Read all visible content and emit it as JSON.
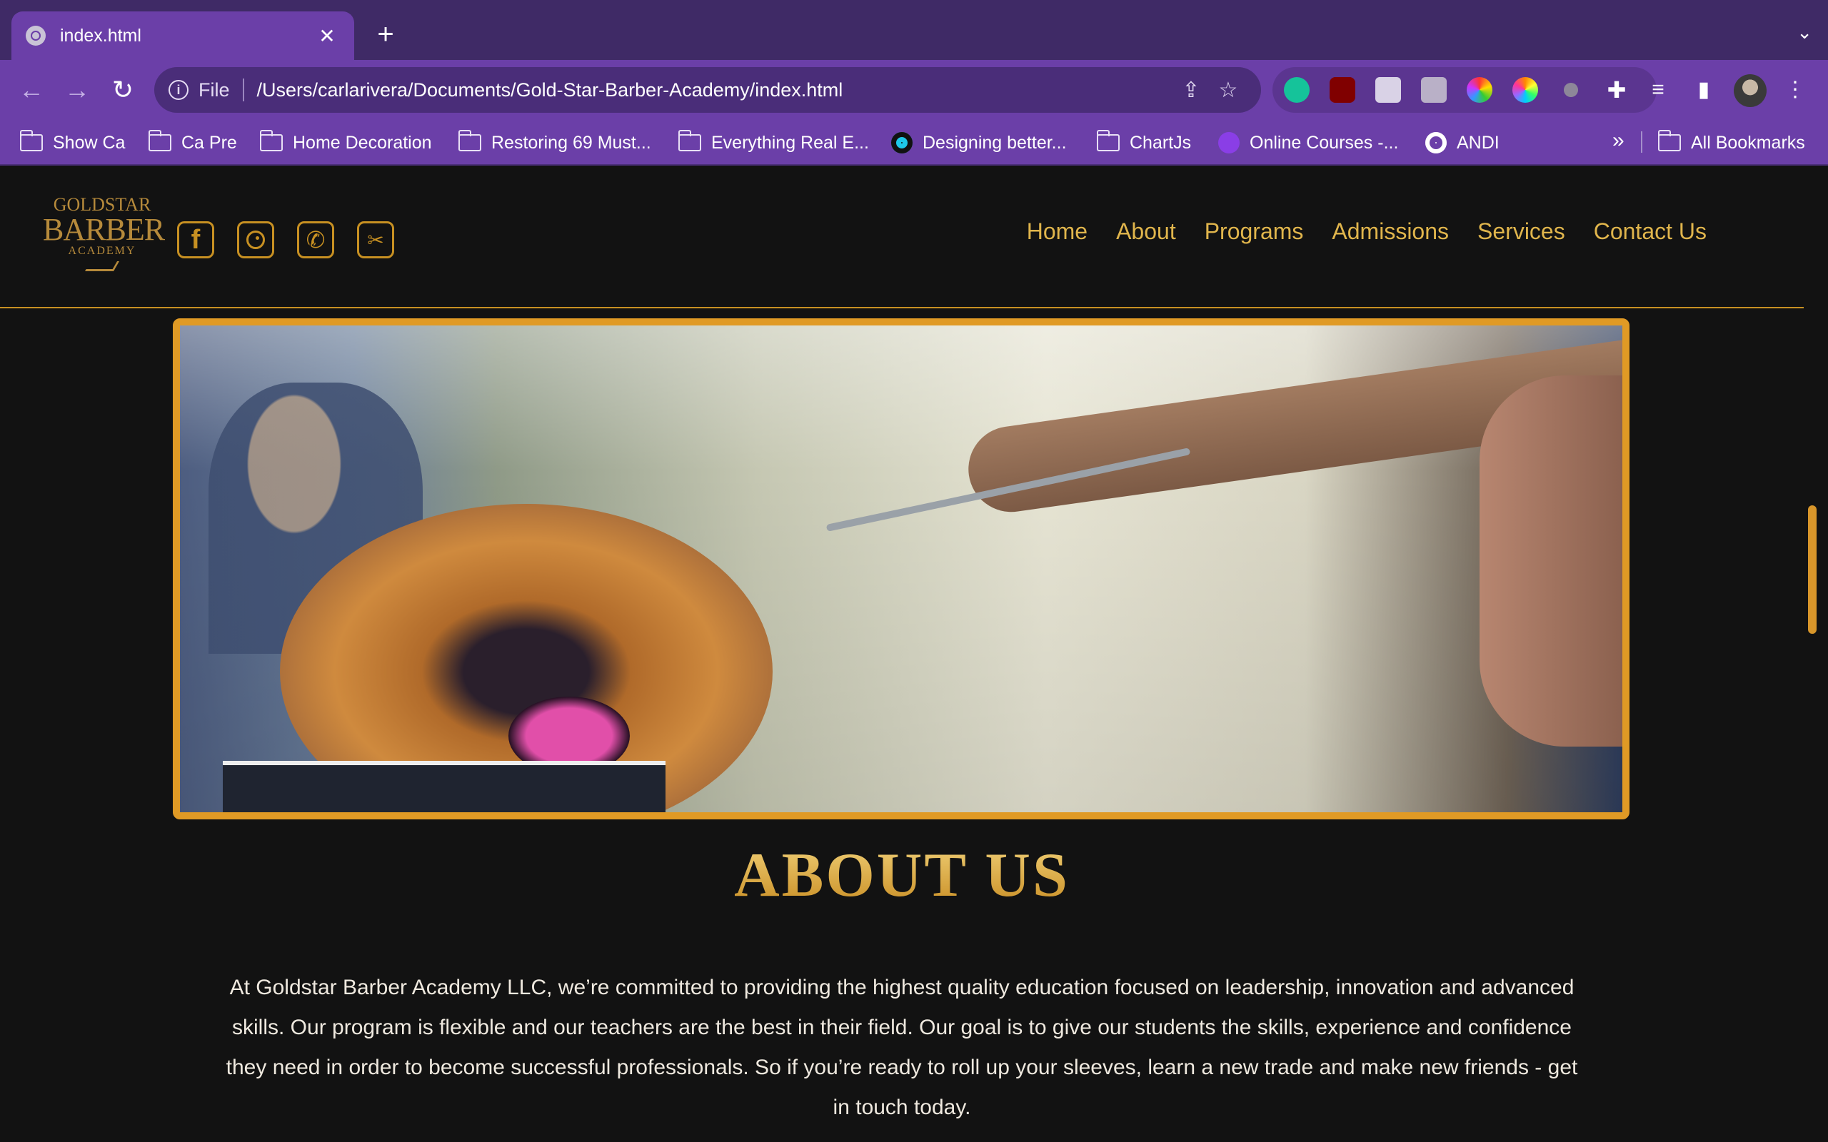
{
  "browser": {
    "tab_title": "index.html",
    "new_tab_label": "+",
    "address_scheme": "File",
    "address_url": "/Users/carlarivera/Documents/Gold-Star-Barber-Academy/index.html",
    "bookmarks": [
      {
        "label": "Show Ca",
        "icon": "folder-icon"
      },
      {
        "label": "Ca Pre",
        "icon": "folder-icon"
      },
      {
        "label": "Home Decoration",
        "icon": "folder-icon"
      },
      {
        "label": "Restoring 69 Must...",
        "icon": "folder-icon"
      },
      {
        "label": "Everything Real E...",
        "icon": "folder-icon"
      },
      {
        "label": "Designing better...",
        "icon": "site-icon"
      },
      {
        "label": "ChartJs",
        "icon": "folder-icon"
      },
      {
        "label": "Online Courses -...",
        "icon": "site-icon"
      },
      {
        "label": "ANDI",
        "icon": "globe-icon"
      }
    ],
    "overflow_label": "»",
    "all_bookmarks_label": "All Bookmarks"
  },
  "site": {
    "logo": {
      "line1": "GOLDSTAR",
      "line2": "BARBER",
      "line3": "ACADEMY"
    },
    "social": [
      {
        "name": "facebook",
        "glyph": "f"
      },
      {
        "name": "instagram",
        "glyph": ""
      },
      {
        "name": "phone",
        "glyph": "✆"
      },
      {
        "name": "barber-clipper",
        "glyph": "✂"
      }
    ],
    "nav": [
      "Home",
      "About",
      "Programs",
      "Admissions",
      "Services",
      "Contact Us"
    ],
    "hero_alt": "Barber cutting lion design haircut",
    "about": {
      "title": "ABOUT US",
      "body": "At Goldstar Barber Academy LLC, we’re committed to providing the highest quality education focused on leadership, innovation and advanced skills. Our program is flexible and our teachers are the best in their field. Our goal is to give our students the skills, experience and confidence they need in order to become successful professionals. So if you’re ready to roll up your sleeves, learn a new trade and make new friends - get in touch today."
    }
  },
  "colors": {
    "chrome": "#6b3fa8",
    "tabstrip": "#3f2a66",
    "gold": "#e0b54c",
    "frame": "#e09a25",
    "page_bg": "#121212"
  }
}
